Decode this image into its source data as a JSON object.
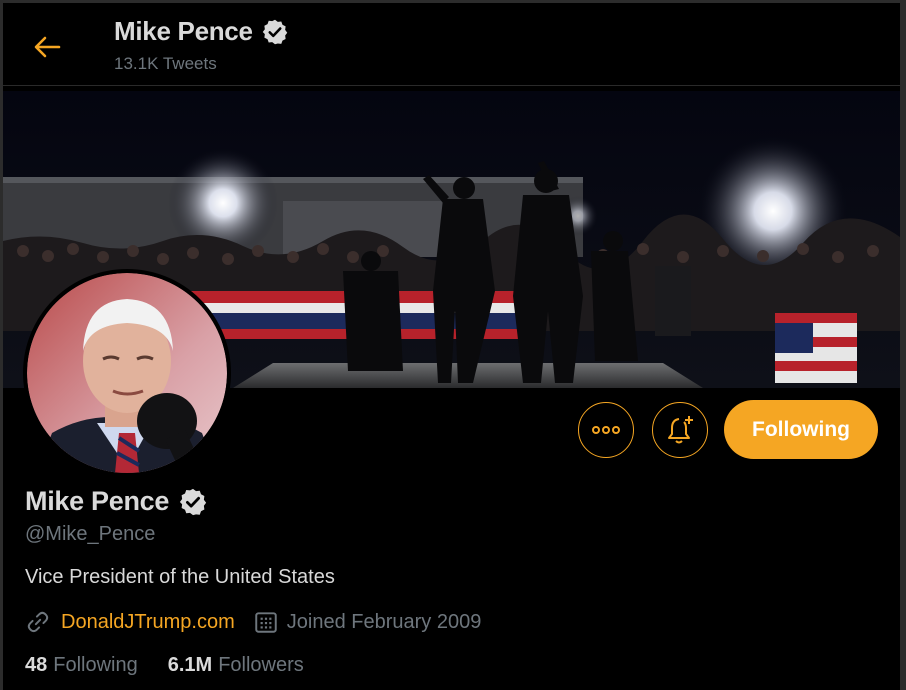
{
  "header": {
    "back_icon": "arrow-left-icon",
    "name": "Mike Pence",
    "tweet_count": "13.1K Tweets"
  },
  "profile": {
    "name": "Mike Pence",
    "handle": "@Mike_Pence",
    "bio": "Vice President of the United States",
    "website": "DonaldJTrump.com",
    "joined": "Joined February 2009",
    "following_count": "48",
    "following_label": "Following",
    "followers_count": "6.1M",
    "followers_label": "Followers"
  },
  "actions": {
    "more_icon": "more-icon",
    "bell_icon": "bell-plus-icon",
    "follow_label": "Following"
  },
  "colors": {
    "accent": "#f5a623",
    "background": "#000000",
    "muted": "#6e767d"
  }
}
